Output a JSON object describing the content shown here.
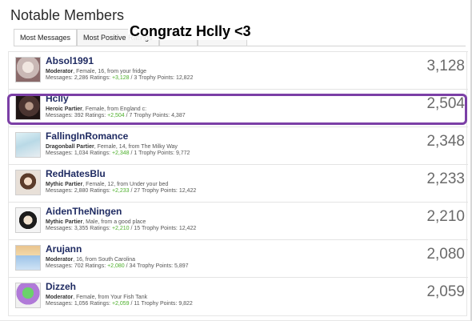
{
  "page": {
    "title": "Notable Members"
  },
  "tabs": [
    {
      "label": "Most Messages"
    },
    {
      "label": "Most Positive Ratings"
    },
    {
      "label": ""
    },
    {
      "label": ""
    }
  ],
  "overlay_text": "Congratz Hclly <3",
  "highlight_color": "#7b3fa6",
  "members": [
    {
      "name": "Absol1991",
      "role": "Moderator",
      "details": ", Female, 16, from your fridge",
      "messages_label": "Messages:",
      "messages": "2,286",
      "ratings_label": "Ratings:",
      "ratings": "+3,128",
      "trophies_label": "/ 3 Trophy Points:",
      "trophy_points": "12,822",
      "score": "3,128",
      "avatar_icon": "avatar-image"
    },
    {
      "name": "Hclly",
      "role": "Heroic Partier",
      "details": ", Female, from England c:",
      "messages_label": "Messages:",
      "messages": "392",
      "ratings_label": "Ratings:",
      "ratings": "+2,504",
      "trophies_label": "/ 7 Trophy Points:",
      "trophy_points": "4,387",
      "score": "2,504",
      "avatar_icon": "avatar-image"
    },
    {
      "name": "FallingInRomance",
      "role": "Dragonball Partier",
      "details": ", Female, 14, from The Milky Way",
      "messages_label": "Messages:",
      "messages": "1,034",
      "ratings_label": "Ratings:",
      "ratings": "+2,348",
      "trophies_label": "/ 1 Trophy Points:",
      "trophy_points": "9,772",
      "score": "2,348",
      "avatar_icon": "avatar-image"
    },
    {
      "name": "RedHatesBlu",
      "role": "Mythic Partier",
      "details": ", Female, 12, from Under your bed",
      "messages_label": "Messages:",
      "messages": "2,880",
      "ratings_label": "Ratings:",
      "ratings": "+2,233",
      "trophies_label": "/ 27 Trophy Points:",
      "trophy_points": "12,422",
      "score": "2,233",
      "avatar_icon": "avatar-image"
    },
    {
      "name": "AidenTheNingen",
      "role": "Mythic Partier",
      "details": ", Male, from a good place",
      "messages_label": "Messages:",
      "messages": "3,355",
      "ratings_label": "Ratings:",
      "ratings": "+2,210",
      "trophies_label": "/ 15 Trophy Points:",
      "trophy_points": "12,422",
      "score": "2,210",
      "avatar_icon": "avatar-image"
    },
    {
      "name": "Arujann",
      "role": "Moderator",
      "details": ", 16, from South Carolina",
      "messages_label": "Messages:",
      "messages": "702",
      "ratings_label": "Ratings:",
      "ratings": "+2,080",
      "trophies_label": "/ 34 Trophy Points:",
      "trophy_points": "5,897",
      "score": "2,080",
      "avatar_icon": "avatar-image"
    },
    {
      "name": "Dizzeh",
      "role": "Moderator",
      "details": ", Female, from Your Fish Tank",
      "messages_label": "Messages:",
      "messages": "1,056",
      "ratings_label": "Ratings:",
      "ratings": "+2,059",
      "trophies_label": "/ 11 Trophy Points:",
      "trophy_points": "9,822",
      "score": "2,059",
      "avatar_icon": "avatar-image"
    }
  ]
}
